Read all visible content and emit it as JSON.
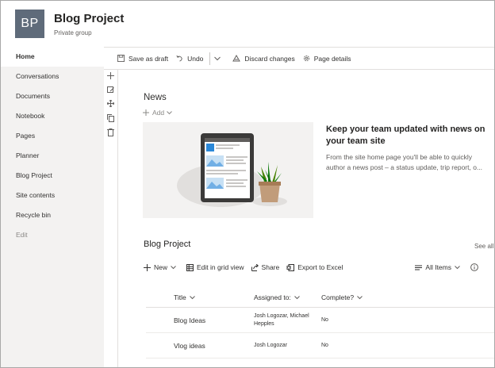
{
  "site": {
    "logo_initials": "BP",
    "title": "Blog Project",
    "subtitle": "Private group"
  },
  "nav": {
    "items": [
      {
        "label": "Home",
        "active": true
      },
      {
        "label": "Conversations"
      },
      {
        "label": "Documents"
      },
      {
        "label": "Notebook"
      },
      {
        "label": "Pages"
      },
      {
        "label": "Planner"
      },
      {
        "label": "Blog Project"
      },
      {
        "label": "Site contents"
      },
      {
        "label": "Recycle bin"
      }
    ],
    "edit_label": "Edit"
  },
  "commandbar": {
    "save_draft": "Save as draft",
    "undo": "Undo",
    "discard": "Discard changes",
    "page_details": "Page details"
  },
  "news": {
    "title": "News",
    "add_label": "Add",
    "headline": "Keep your team updated with news on your team site",
    "body": "From the site home page you'll be able to quickly author a news post – a status update, trip report, o..."
  },
  "list": {
    "title": "Blog Project",
    "see_all": "See all",
    "commands": {
      "new": "New",
      "grid_view": "Edit in grid view",
      "share": "Share",
      "export": "Export to Excel",
      "view": "All Items"
    },
    "columns": [
      "Title",
      "Assigned to:",
      "Complete?"
    ],
    "rows": [
      {
        "title": "Blog Ideas",
        "assigned": "Josh Logozar, Michael Hepples",
        "complete": "No"
      },
      {
        "title": "Vlog ideas",
        "assigned": "Josh Logozar",
        "complete": "No"
      }
    ]
  },
  "colors": {
    "logo_bg": "#5f6b7a",
    "nav_bg": "#f3f2f1",
    "accent": "#0078d4"
  }
}
